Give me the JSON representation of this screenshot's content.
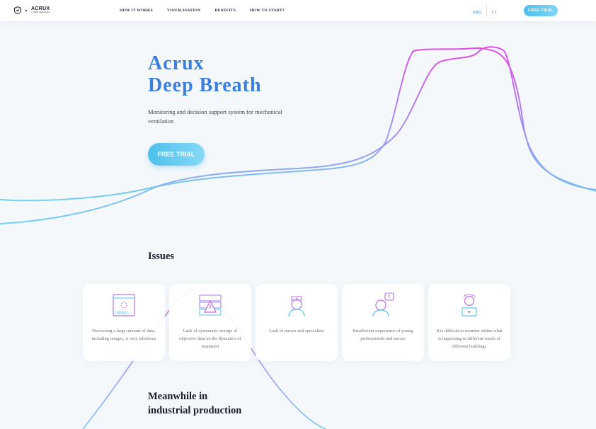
{
  "header": {
    "logo": {
      "name": "ACRUX",
      "sub": "CYBER SERVICES"
    },
    "nav": [
      "HOW IT WORKS",
      "VISUALISATION",
      "BENEFITS",
      "HOW TO START?"
    ],
    "lang_active": "ENG",
    "lang_other": "LT",
    "trial_button": "FREE TRIAL"
  },
  "hero": {
    "title_line1": "Acrux",
    "title_line2": "Deep Breath",
    "subtitle": "Monitoring and decision support system for mechanical ventilation",
    "button": "FREE TRIAL"
  },
  "issues": {
    "title": "Issues",
    "cards": [
      {
        "icon": "loading-screen-icon",
        "icon_text": "Loading...",
        "text": "Processing a large amount of data, including images, is very laborious"
      },
      {
        "icon": "server-warning-icon",
        "text": "Lack of systematic storage of objective data on the dynamics of treatment"
      },
      {
        "icon": "nurse-icon",
        "text": "Lack of nurses and specialists"
      },
      {
        "icon": "confused-nurse-icon",
        "text": "Insufficient experience of young professionals and nurses"
      },
      {
        "icon": "remote-monitor-icon",
        "text": "It is difficult to monitor online what is happening in different wards of different buildings"
      }
    ]
  },
  "meanwhile": {
    "line1": "Meanwhile in",
    "line2": "industrial production"
  },
  "colors": {
    "accent_blue": "#3b7fdc",
    "cyan": "#6fd3ef",
    "magenta": "#d94fe8"
  }
}
